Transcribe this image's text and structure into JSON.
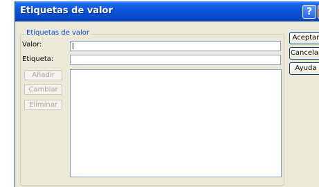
{
  "window": {
    "title": "Etiquetas de valor"
  },
  "titlebar": {
    "help_label": "?"
  },
  "group": {
    "legend": "Etiquetas de valor",
    "value_label": "Valor:",
    "value_text": "",
    "label_label": "Etiqueta:",
    "label_text": ""
  },
  "list_buttons": {
    "add": "Añadir",
    "change": "Cambiar",
    "remove": "Eliminar"
  },
  "dialog_buttons": {
    "ok": "Aceptar",
    "cancel": "Cancelar",
    "help": "Ayuda"
  },
  "colors": {
    "titlebar": "#0a53d8",
    "dialog_bg": "#ece9d8",
    "legend_text": "#0046d5",
    "disabled_text": "#a7a696"
  }
}
